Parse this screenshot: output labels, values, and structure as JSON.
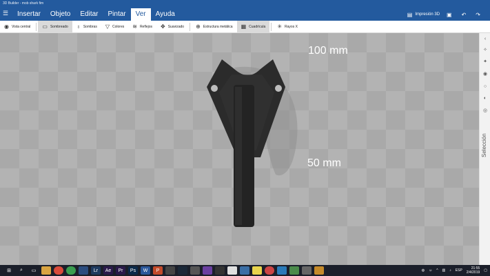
{
  "window": {
    "title": "3D Builder - mob shark fim"
  },
  "menu": {
    "items": [
      {
        "label": "Insertar"
      },
      {
        "label": "Objeto"
      },
      {
        "label": "Editar"
      },
      {
        "label": "Pintar"
      },
      {
        "label": "Ver",
        "active": true
      },
      {
        "label": "Ayuda"
      }
    ],
    "right": {
      "print_label": "Impresión 3D"
    }
  },
  "toolbar": {
    "items": [
      {
        "label": "Vista central",
        "icon": "eye-icon"
      },
      {
        "label": "Sombreado",
        "icon": "shading-icon",
        "active": true
      },
      {
        "label": "Sombras",
        "icon": "bulb-icon"
      },
      {
        "label": "Colores",
        "icon": "paint-icon"
      },
      {
        "label": "Reflejos",
        "icon": "reflect-icon"
      },
      {
        "label": "Suavizado",
        "icon": "smooth-icon"
      },
      {
        "label": "Estructura metálica",
        "icon": "globe-icon"
      },
      {
        "label": "Cuadrícula",
        "icon": "grid-icon",
        "active": true
      },
      {
        "label": "Rayos X",
        "icon": "xray-icon"
      }
    ]
  },
  "canvas": {
    "dim_width": "100 mm",
    "dim_height": "50 mm"
  },
  "side_panel": {
    "label": "Selección"
  },
  "taskbar": {
    "lang": "ESP",
    "time": "21:55",
    "date": "2/4/2019"
  },
  "colors": {
    "accent": "#235a9e",
    "model": "#2b2b2b",
    "grid_light": "#b3b3b3",
    "grid_dark": "#a9a9a9"
  }
}
